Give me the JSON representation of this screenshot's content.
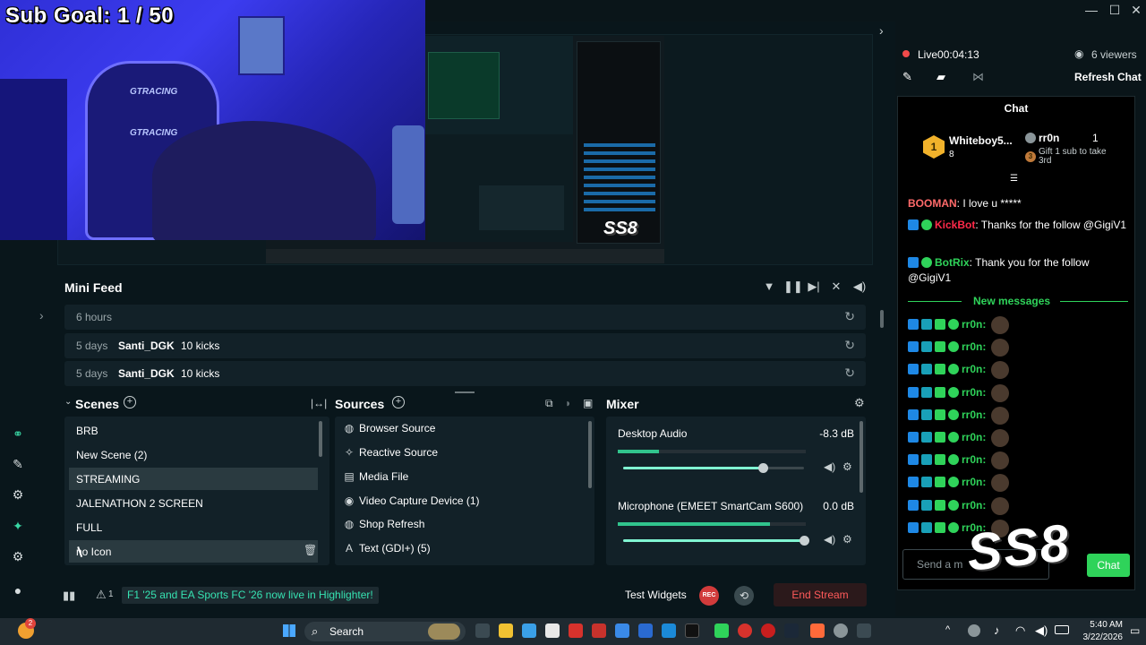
{
  "window": {
    "minimize": "—",
    "maximize": "☐",
    "close": "✕"
  },
  "overlay": {
    "sub_goal": "Sub Goal:  1 / 50",
    "chair_brand": "GTRACING",
    "watermark": "SS8"
  },
  "mini_feed": {
    "title": "Mini Feed",
    "rows": [
      {
        "time": "6 hours",
        "user": "",
        "detail": ""
      },
      {
        "time": "5 days",
        "user": "Santi_DGK",
        "detail": "10 kicks"
      },
      {
        "time": "5 days",
        "user": "Santi_DGK",
        "detail": "10 kicks"
      }
    ]
  },
  "scenes": {
    "title": "Scenes",
    "items": [
      {
        "label": "BRB"
      },
      {
        "label": "New Scene (2)"
      },
      {
        "label": "STREAMING",
        "active": true
      },
      {
        "label": "JALENATHON 2 SCREEN"
      },
      {
        "label": "FULL"
      },
      {
        "label": "no Icon"
      }
    ]
  },
  "sources": {
    "title": "Sources",
    "items": [
      {
        "icon": "globe-icon",
        "label": "Browser Source"
      },
      {
        "icon": "sparkle-icon",
        "label": "Reactive Source"
      },
      {
        "icon": "film-icon",
        "label": "Media File"
      },
      {
        "icon": "camera-icon",
        "label": "Video Capture Device (1)"
      },
      {
        "icon": "globe-icon",
        "label": "Shop Refresh"
      },
      {
        "icon": "text-icon",
        "label": "Text (GDI+) (5)"
      }
    ]
  },
  "mixer": {
    "title": "Mixer",
    "channels": [
      {
        "name": "Desktop Audio",
        "db": "-8.3 dB",
        "volume": 0.77,
        "level": 0.22
      },
      {
        "name": "Microphone (EMEET SmartCam S600)",
        "db": "0.0 dB",
        "volume": 1.0,
        "level": 0.81
      }
    ]
  },
  "footer": {
    "count": "1",
    "banner": "F1 '25 and EA Sports FC '26 now live in Highlighter!",
    "test_widgets": "Test Widgets",
    "rec": "REC",
    "end_stream": "End Stream"
  },
  "stream": {
    "status": "Live",
    "duration": "00:04:13",
    "viewers": "6 viewers",
    "refresh_chat": "Refresh Chat"
  },
  "chat": {
    "title": "Chat",
    "top_supporters": [
      {
        "rank": "1",
        "name": "Whiteboy5...",
        "count": "8"
      },
      {
        "name": "rr0n",
        "count": "1",
        "note": "Gift 1 sub to take 3rd",
        "rank": "3"
      }
    ],
    "messages": [
      {
        "user": "BOOMAN",
        "text": ": I love u *****"
      },
      {
        "user": "KickBot",
        "text": ": Thanks for the follow @GigiV1"
      },
      {
        "user": "BotRix",
        "text": ": Thank you for the follow @GigiV1"
      }
    ],
    "new_messages_label": "New messages",
    "new_message_user": "rr0n:",
    "new_message_count": 10,
    "input_placeholder": "Send a m",
    "send": "Chat"
  },
  "taskbar": {
    "search": "Search",
    "time": "5:40 AM",
    "date": "3/22/2026",
    "notification_count": "2"
  },
  "colors": {
    "accent": "#31c48d",
    "chat_green": "#2fd35a",
    "live_red": "#f14a4a",
    "end_stream": "#ff5a5a"
  }
}
